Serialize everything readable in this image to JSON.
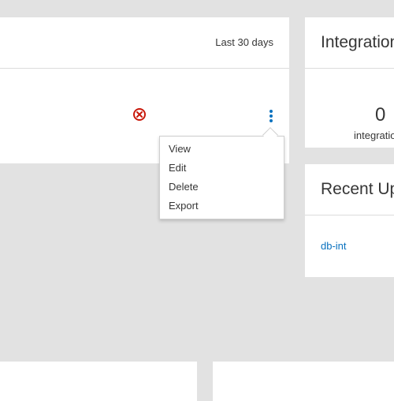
{
  "main_card": {
    "period_label": "Last 30 days"
  },
  "kebab_menu": {
    "items": [
      {
        "label": "View"
      },
      {
        "label": "Edit"
      },
      {
        "label": "Delete"
      },
      {
        "label": "Export"
      }
    ]
  },
  "integrations_card": {
    "title": "Integrations",
    "count": "0",
    "count_label": "integrations"
  },
  "recent_updates_card": {
    "title": "Recent Updates",
    "items": [
      {
        "label": "db-int"
      }
    ]
  },
  "colors": {
    "background": "#e2e2e2",
    "card": "#ffffff",
    "error": "#c9190b",
    "link": "#0a72bf",
    "kebab": "#0a72bf"
  },
  "icons": {
    "status": "error-circle-x-icon",
    "actions": "kebab-vertical-icon"
  }
}
